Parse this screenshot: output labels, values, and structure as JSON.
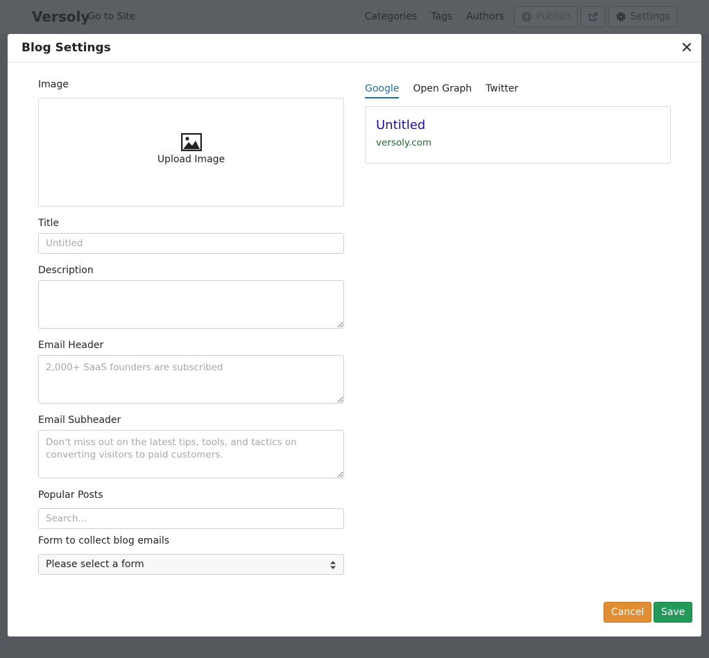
{
  "app": {
    "brand": "Versoly",
    "go_to_site": "Go to Site",
    "nav": [
      "Categories",
      "Tags",
      "Authors"
    ],
    "publish_label": "Publish",
    "settings_label": "Settings"
  },
  "modal": {
    "title": "Blog Settings",
    "close_icon": "close-icon",
    "image": {
      "label": "Image",
      "upload_text": "Upload Image",
      "icon": "image-icon"
    },
    "title_field": {
      "label": "Title",
      "value": "",
      "placeholder": "Untitled"
    },
    "description_field": {
      "label": "Description",
      "value": "",
      "placeholder": ""
    },
    "email_header_field": {
      "label": "Email Header",
      "value": "",
      "placeholder": "2,000+ SaaS founders are subscribed"
    },
    "email_subheader_field": {
      "label": "Email Subheader",
      "value": "",
      "placeholder": "Don't miss out on the latest tips, tools, and tactics on converting visitors to paid customers."
    },
    "popular_posts_field": {
      "label": "Popular Posts",
      "value": "",
      "placeholder": "Search..."
    },
    "form_select": {
      "label": "Form to collect blog emails",
      "selected": "Please select a form"
    },
    "preview": {
      "tabs": [
        {
          "label": "Google",
          "active": true
        },
        {
          "label": "Open Graph",
          "active": false
        },
        {
          "label": "Twitter",
          "active": false
        }
      ],
      "title": "Untitled",
      "url": "versoly.com"
    },
    "buttons": {
      "cancel": "Cancel",
      "save": "Save"
    }
  },
  "colors": {
    "accent": "#1f6fa3",
    "cancel": "#e08d33",
    "save": "#239a5a",
    "preview_title": "#1a0dab",
    "preview_url": "#1c6b2e"
  }
}
